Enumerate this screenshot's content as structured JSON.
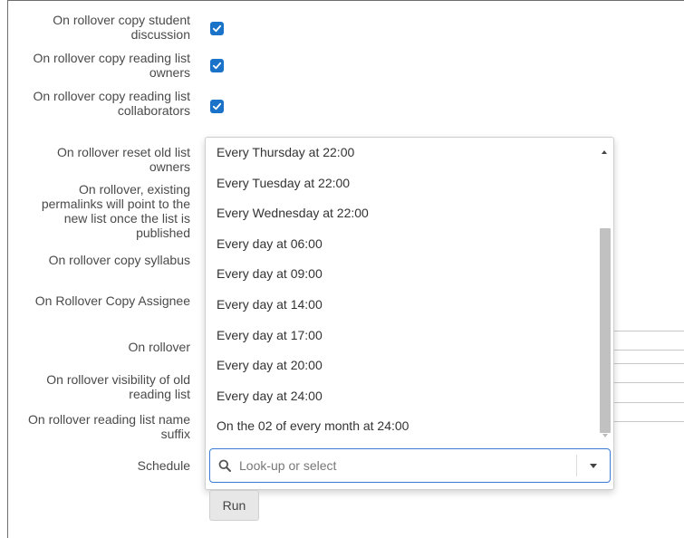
{
  "form": {
    "fields": [
      {
        "name": "copy-student-discussion",
        "label": "On rollover copy student discussion",
        "checked": true
      },
      {
        "name": "copy-reading-list-owners",
        "label": "On rollover copy reading list owners",
        "checked": true
      },
      {
        "name": "copy-reading-list-collaborators",
        "label": "On rollover copy reading list collaborators",
        "checked": true
      }
    ],
    "labels": {
      "reset_owners": "On rollover reset old list owners",
      "permalinks": "On rollover, existing permalinks will point to the new list once the list is published",
      "copy_syllabus": "On rollover copy syllabus",
      "copy_assignee": "On Rollover Copy Assignee",
      "on_rollover": "On rollover",
      "visibility": "On rollover visibility of old reading list",
      "name_suffix": "On rollover reading list name suffix",
      "schedule": "Schedule"
    }
  },
  "schedule_dropdown": {
    "options": [
      "Every Thursday at 22:00",
      "Every Tuesday at 22:00",
      "Every Wednesday at 22:00",
      "Every day at 06:00",
      "Every day at 09:00",
      "Every day at 14:00",
      "Every day at 17:00",
      "Every day at 20:00",
      "Every day at 24:00",
      "On the 02 of every month at 24:00"
    ],
    "search_placeholder": "Look-up or select"
  },
  "actions": {
    "run_label": "Run"
  },
  "colors": {
    "checkbox": "#1a73c9",
    "focus_border": "#3a7bd5"
  }
}
